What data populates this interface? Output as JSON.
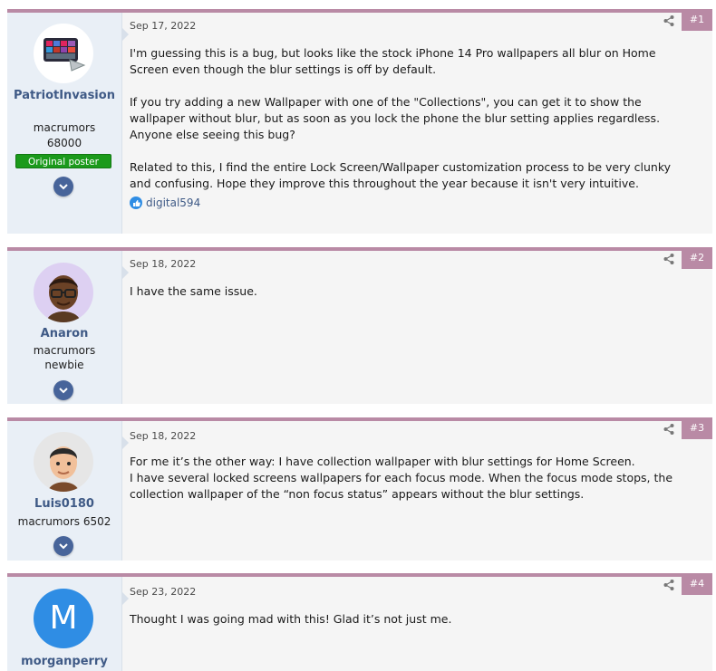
{
  "posts": [
    {
      "username": "PatriotInvasion",
      "user_title_1": "macrumors",
      "user_title_2": "68000",
      "badge": "Original poster",
      "date": "Sep 17, 2022",
      "number": "#1",
      "paragraphs": [
        "I'm guessing this is a bug, but looks like the stock iPhone 14 Pro wallpapers all blur on Home Screen even though the blur settings is off by default.",
        "If you try adding a new Wallpaper with one of the \"Collections\", you can get it to show the wallpaper without blur, but as soon as you lock the phone the blur setting applies regardless. Anyone else seeing this bug?",
        "Related to this, I find the entire Lock Screen/Wallpaper customization process to be very clunky and confusing. Hope they improve this throughout the year because it isn't very intuitive."
      ],
      "reaction_user": "digital594"
    },
    {
      "username": "Anaron",
      "user_title_1": "macrumors",
      "user_title_2": "newbie",
      "date": "Sep 18, 2022",
      "number": "#2",
      "paragraphs": [
        "I have the same issue."
      ]
    },
    {
      "username": "Luis0180",
      "user_title_1": "macrumors 6502",
      "date": "Sep 18, 2022",
      "number": "#3",
      "lines": [
        "For me it’s the other way: I have collection wallpaper with blur settings for Home Screen.",
        "I have several locked screens wallpapers for each focus mode. When the focus mode stops, the collection wallpaper of the “non focus status” appears without the blur settings."
      ]
    },
    {
      "username": "morganperry",
      "avatar_letter": "M",
      "date": "Sep 23, 2022",
      "number": "#4",
      "paragraphs": [
        "Thought I was going mad with this! Glad it’s not just me."
      ]
    }
  ],
  "colors": {
    "accent": "#b98aa5",
    "username": "#3f5a86",
    "op_badge": "#1b9a1b",
    "user_cell": "#e9eff6",
    "m_avatar": "#2f8de4"
  },
  "icons": {
    "share": "share-icon",
    "expand": "chevron-down-icon",
    "like": "like-icon"
  }
}
